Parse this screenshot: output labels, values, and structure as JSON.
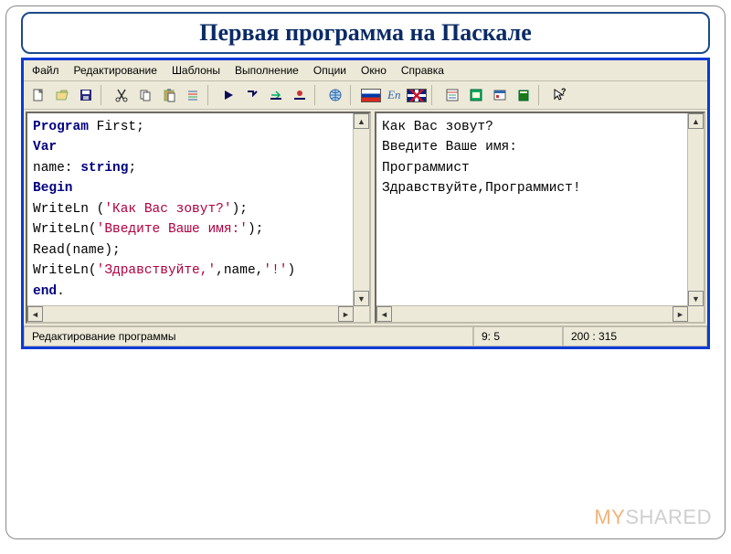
{
  "title": "Первая программа на Паскале",
  "menu": [
    "Файл",
    "Редактирование",
    "Шаблоны",
    "Выполнение",
    "Опции",
    "Окно",
    "Справка"
  ],
  "toolbar": {
    "en_label": "En"
  },
  "code_tokens": [
    {
      "cls": "kw",
      "t": "Program "
    },
    {
      "cls": "txt",
      "t": "First;"
    },
    {
      "cls": "",
      "t": "\n"
    },
    {
      "cls": "kw",
      "t": "Var"
    },
    {
      "cls": "",
      "t": "\n"
    },
    {
      "cls": "txt",
      "t": "name: "
    },
    {
      "cls": "kw",
      "t": "string"
    },
    {
      "cls": "txt",
      "t": ";"
    },
    {
      "cls": "",
      "t": "\n"
    },
    {
      "cls": "kw",
      "t": "Begin"
    },
    {
      "cls": "",
      "t": "\n"
    },
    {
      "cls": "txt",
      "t": "WriteLn ("
    },
    {
      "cls": "str",
      "t": "'Как Вас зовут?'"
    },
    {
      "cls": "txt",
      "t": ");"
    },
    {
      "cls": "",
      "t": "\n"
    },
    {
      "cls": "txt",
      "t": "WriteLn("
    },
    {
      "cls": "str",
      "t": "'Введите Ваше имя:'"
    },
    {
      "cls": "txt",
      "t": ");"
    },
    {
      "cls": "",
      "t": "\n"
    },
    {
      "cls": "txt",
      "t": "Read(name);"
    },
    {
      "cls": "",
      "t": "\n"
    },
    {
      "cls": "txt",
      "t": "WriteLn("
    },
    {
      "cls": "str",
      "t": "'Здравствуйте,'"
    },
    {
      "cls": "txt",
      "t": ",name,"
    },
    {
      "cls": "str",
      "t": "'!'"
    },
    {
      "cls": "txt",
      "t": ")"
    },
    {
      "cls": "",
      "t": "\n"
    },
    {
      "cls": "kw",
      "t": "end"
    },
    {
      "cls": "txt",
      "t": "."
    }
  ],
  "output_lines": [
    "Как Вас зовут?",
    "Введите Ваше имя:",
    "Программист",
    "Здравствуйте,Программист!"
  ],
  "status": {
    "mode": "Редактирование программы",
    "cursor": "9: 5",
    "size": "200 : 315"
  },
  "watermark": {
    "my": "MY",
    "shared": "SHARED"
  }
}
